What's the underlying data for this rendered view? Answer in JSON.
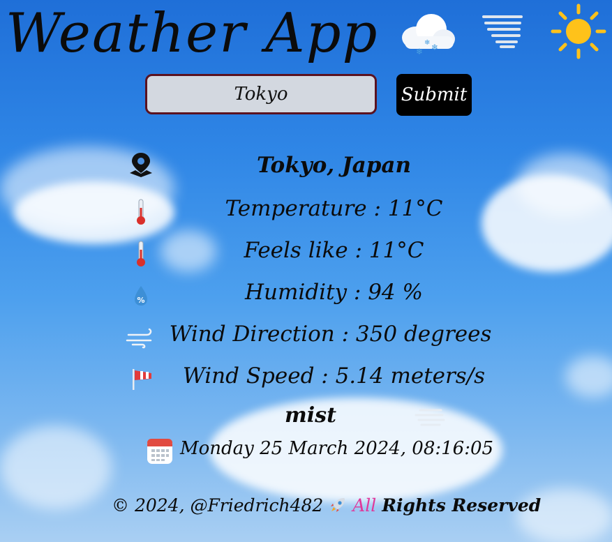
{
  "app": {
    "title": "Weather App"
  },
  "header_icons": [
    "snow-cloud-icon",
    "mist-lines-icon",
    "sun-icon"
  ],
  "search": {
    "value": "Tokyo",
    "submit_label": "Submit"
  },
  "weather": {
    "location": "Tokyo, Japan",
    "temperature": "Temperature : 11°C",
    "feels_like": "Feels like : 11°C",
    "humidity": "Humidity : 94 %",
    "wind_direction": "Wind Direction : 350 degrees",
    "wind_speed": "Wind Speed : 5.14 meters/s",
    "description": "mist",
    "datetime": "Monday 25 March 2024, 08:16:05"
  },
  "footer": {
    "prefix": "© 2024, @Friedrich482",
    "all": "All",
    "rest": "Rights Reserved"
  },
  "colors": {
    "accent_pink": "#e0389a",
    "input_border": "#5a1220",
    "submit_bg": "#000000"
  }
}
